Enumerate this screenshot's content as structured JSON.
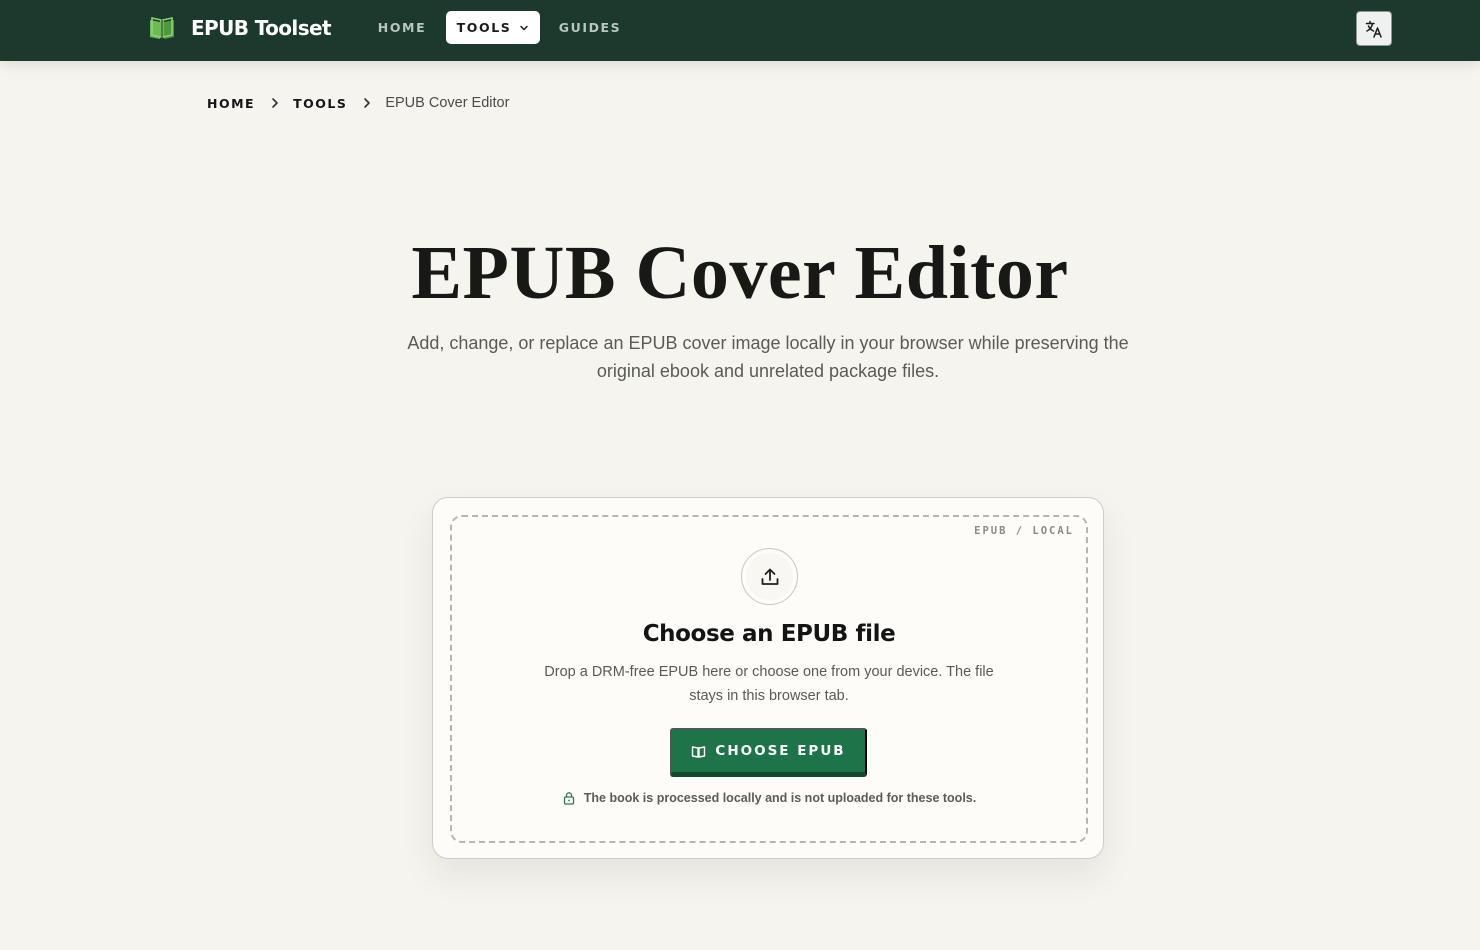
{
  "header": {
    "brand": "EPUB Toolset",
    "nav": [
      {
        "label": "HOME"
      },
      {
        "label": "TOOLS"
      },
      {
        "label": "GUIDES"
      }
    ],
    "language_icon": "translate-icon"
  },
  "breadcrumb": {
    "items": [
      "HOME",
      "TOOLS"
    ],
    "current": "EPUB Cover Editor"
  },
  "hero": {
    "title": "EPUB Cover Editor",
    "subtitle": "Add, change, or replace an EPUB cover image locally in your browser while preserving the original ebook and unrelated package files."
  },
  "upload": {
    "tag": "EPUB / LOCAL",
    "title": "Choose an EPUB file",
    "description": "Drop a DRM-free EPUB here or choose one from your device. The file stays in this browser tab.",
    "button_label": "CHOOSE EPUB",
    "privacy_note": "The book is processed locally and is not uploaded for these tools."
  },
  "colors": {
    "header_bg": "#1b3a2d",
    "accent_green": "#1e7449",
    "page_bg": "#f6f4ee"
  }
}
